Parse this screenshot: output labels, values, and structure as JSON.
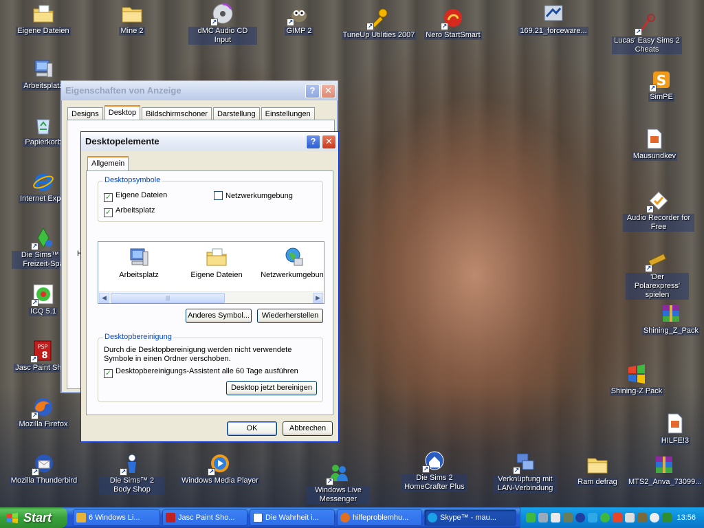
{
  "desktop": {
    "icons_left": [
      {
        "label": "Eigene Dateien",
        "icon": "folder-documents-icon"
      },
      {
        "label": "Mine 2",
        "icon": "folder-icon"
      },
      {
        "label": "dMC Audio CD Input",
        "icon": "cd-icon"
      },
      {
        "label": "GIMP 2",
        "icon": "gimp-icon"
      },
      {
        "label": "TuneUp Utilities 2007",
        "icon": "tuneup-icon"
      },
      {
        "label": "Nero StartSmart",
        "icon": "nero-icon"
      },
      {
        "label": "169.21_forceware...",
        "icon": "installer-icon"
      },
      {
        "label": "Lucas' Easy Sims 2 Cheats",
        "icon": "sims-cheats-icon"
      },
      {
        "label": "Arbeitsplatz",
        "icon": "computer-icon"
      },
      {
        "label": "Papierkorb",
        "icon": "recycle-bin-icon"
      },
      {
        "label": "Internet Explo",
        "icon": "internet-explorer-icon"
      },
      {
        "label": "Die Sims™ 2 Freizeit-Spa",
        "icon": "sims-icon"
      },
      {
        "label": "ICQ 5.1",
        "icon": "icq-icon"
      },
      {
        "label": "Jasc Paint Shop",
        "icon": "paintshop-icon"
      },
      {
        "label": "Mozilla Firefox",
        "icon": "firefox-icon"
      },
      {
        "label": "Mozilla Thunderbird",
        "icon": "thunderbird-icon"
      },
      {
        "label": "Die Sims™ 2 Body Shop",
        "icon": "bodyshop-icon"
      },
      {
        "label": "Windows Media Player",
        "icon": "media-player-icon"
      },
      {
        "label": "Windows Live Messenger",
        "icon": "messenger-icon"
      },
      {
        "label": "Die Sims 2 HomeCrafter Plus",
        "icon": "homecrafter-icon"
      },
      {
        "label": "Verknüpfung mit LAN-Verbindung",
        "icon": "network-connection-icon"
      },
      {
        "label": "Ram defrag",
        "icon": "folder-icon"
      },
      {
        "label": "MTS2_Anva_73099...",
        "icon": "winrar-icon"
      },
      {
        "label": "SimPE",
        "icon": "simpe-icon"
      },
      {
        "label": "Mausundkev",
        "icon": "document-icon"
      },
      {
        "label": "Audio Recorder for Free",
        "icon": "audio-recorder-icon"
      },
      {
        "label": "'Der Polarexpress' spielen",
        "icon": "polarexpress-icon"
      },
      {
        "label": "Shining_Z_Pack",
        "icon": "winrar-icon"
      },
      {
        "label": "Shining-Z Pack",
        "icon": "windows-flag-icon"
      },
      {
        "label": "HILFE!3",
        "icon": "document-icon"
      }
    ]
  },
  "back_window": {
    "title": "Eigenschaften von Anzeige",
    "tabs": [
      "Designs",
      "Desktop",
      "Bildschirmschoner",
      "Darstellung",
      "Einstellungen"
    ],
    "selected_tab": "Desktop",
    "partial_label": "H"
  },
  "dialog": {
    "title": "Desktopelemente",
    "tab": "Allgemein",
    "icons_group": {
      "title": "Desktopsymbole",
      "checkboxes": [
        {
          "label": "Eigene Dateien",
          "checked": true
        },
        {
          "label": "Arbeitsplatz",
          "checked": true
        },
        {
          "label": "Netzwerkumgebung",
          "checked": false
        }
      ]
    },
    "icon_list": [
      {
        "label": "Arbeitsplatz",
        "icon": "computer-icon"
      },
      {
        "label": "Eigene Dateien",
        "icon": "folder-documents-icon"
      },
      {
        "label": "Netzwerkumgebung",
        "icon": "network-icon"
      }
    ],
    "buttons": {
      "change_icon": "Anderes Symbol...",
      "restore": "Wiederherstellen",
      "clean_now": "Desktop jetzt bereinigen",
      "ok": "OK",
      "cancel": "Abbrechen"
    },
    "cleanup_group": {
      "title": "Desktopbereinigung",
      "description": "Durch die Desktopbereinigung werden nicht verwendete Symbole in einen Ordner verschoben.",
      "checkbox": {
        "label": "Desktopbereinigungs-Assistent alle 60 Tage ausführen",
        "checked": true
      }
    }
  },
  "taskbar": {
    "start_label": "Start",
    "tasks": [
      {
        "label": "6 Windows Li...",
        "active": false,
        "color": "#e8b33a"
      },
      {
        "label": "Jasc Paint Sho...",
        "active": false,
        "color": "#c02020"
      },
      {
        "label": "Die Wahrheit i...",
        "active": false,
        "color": "#2b5cc0"
      },
      {
        "label": "hilfeproblemhu...",
        "active": false,
        "color": "#e07020"
      },
      {
        "label": "Skype™ - mau...",
        "active": true,
        "color": "#19a0e8"
      }
    ],
    "clock": "13:56"
  },
  "colors": {
    "title_active": "#0831d9",
    "group_title": "#0046d5",
    "taskbar_blue": "#2257d5",
    "start_green": "#39a039",
    "tray_blue": "#0c8ad8"
  }
}
